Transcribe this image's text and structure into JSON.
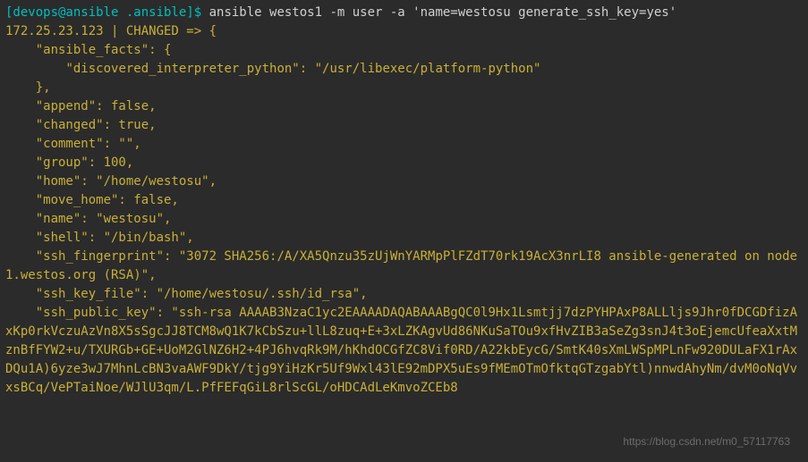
{
  "terminal": {
    "prompt": "[devops@ansible .ansible]$",
    "command": " ansible westos1 -m user -a 'name=westosu generate_ssh_key=yes'",
    "output_lines": [
      "172.25.23.123 | CHANGED => {",
      "    \"ansible_facts\": {",
      "        \"discovered_interpreter_python\": \"/usr/libexec/platform-python\"",
      "    },",
      "    \"append\": false,",
      "    \"changed\": true,",
      "    \"comment\": \"\",",
      "    \"group\": 100,",
      "    \"home\": \"/home/westosu\",",
      "    \"move_home\": false,",
      "    \"name\": \"westosu\",",
      "    \"shell\": \"/bin/bash\",",
      "    \"ssh_fingerprint\": \"3072 SHA256:/A/XA5Qnzu35zUjWnYARMpPlFZdT70rk19AcX3nrLI8 ansible-generated on node1.westos.org (RSA)\",",
      "    \"ssh_key_file\": \"/home/westosu/.ssh/id_rsa\",",
      "    \"ssh_public_key\": \"ssh-rsa AAAAB3NzaC1yc2EAAAADAQABAAABgQC0l9Hx1Lsmtjj7dzPYHPAxP8ALLljs9Jhr0fDCGDfizAxKp0rkVczuAzVn8X5sSgcJJ8TCM8wQ1K7kCbSzu+llL8zuq+E+3xLZKAgvUd86NKuSaTOu9xfHvZIB3aSeZg3snJ4t3oEjemcUfeaXxtMznBfFYW2+u/TXURGb+GE+UoM2GlNZ6H2+4PJ6hvqRk9M/hKhdOCGfZC8Vif0RD/A22kbEycG/SmtK40sXmLWSpMPLnFw920DULaFX1rAxDQu1A)6yze3wJ7MhnLcBN3vaAWF9DkY/tjg9YiHzKr5Uf9Wxl43lE92mDPX5uEs9fMEmOTmOfktqGTzgabYtl)nnwdAhyNm/dvM0oNqVvxsBCq/VePTaiNoe/WJlU3qm/L.PfFEFqGiL8rlScGL/oHDCAdLeKmvoZCEb8"
    ]
  },
  "watermark": "https://blog.csdn.net/m0_57117763"
}
